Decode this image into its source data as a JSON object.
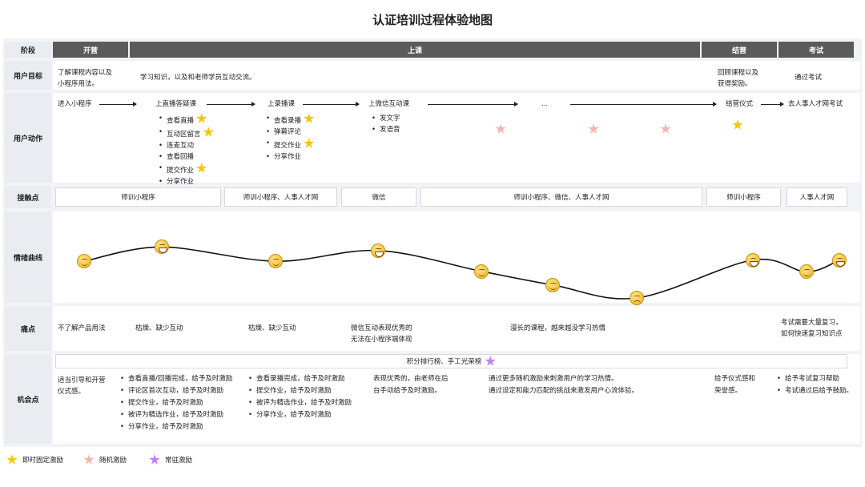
{
  "title": "认证培训过程体验地图",
  "row_labels": {
    "stage": "阶段",
    "goal": "用户目标",
    "action": "用户动作",
    "touch": "接触点",
    "emotion": "情绪曲线",
    "pain": "痛点",
    "opportunity": "机会点"
  },
  "phases": [
    "开营",
    "上课",
    "结营",
    "考试"
  ],
  "goals": [
    "了解课程内容以及",
    "小程序用法。",
    "学习知识，以及和老师学员互动交流。",
    "回顾课程以及",
    "获得奖励。",
    "通过考试"
  ],
  "actions": {
    "steps": [
      "进入小程序",
      "上直播答疑课",
      "上录播课",
      "上微信互动课",
      "...",
      "结营仪式",
      "去人事人才网考试"
    ],
    "live_items": [
      "查看直播",
      "互动区留言",
      "连麦互动",
      "查看回播",
      "提交作业",
      "分享作业"
    ],
    "recorded_items": [
      "查看录播",
      "弹幕评论",
      "提交作业",
      "分享作业"
    ],
    "wechat_items": [
      "发文字",
      "发语音"
    ]
  },
  "touchpoints": [
    "师训小程序",
    "师训小程序、人事人才网",
    "微信",
    "师训小程序、微信、人事人才网",
    "师训小程序",
    "人事人才网"
  ],
  "pains": {
    "p1": "不了解产品用法",
    "p2": "枯燥、缺少互动",
    "p3": "枯燥、缺少互动",
    "p4a": "微信互动表现优秀的",
    "p4b": "无法在小程序端体现",
    "p5": "漫长的课程，越来越没学习热情",
    "p6a": "考试需要大量复习，",
    "p6b": "如何快速复习知识点"
  },
  "opportunity": {
    "bar": "积分排行榜、手工光荣榜",
    "c1a": "适当引导和开营",
    "c1b": "仪式感。",
    "c2": [
      "查看直播/回播完成，给予及时激励",
      "评论区首次互动，给予及时激励",
      "提交作业，给予及时激励",
      "被评为精选作业，给予及时激励",
      "分享作业，给予及时激励"
    ],
    "c3": [
      "查看录播完成，给予及时激励",
      "提交作业，给予及时激励",
      "被评为精选作业，给予及时激励",
      "分享作业，给予及时激励"
    ],
    "c4a": "表现优秀的，由老师在后",
    "c4b": "台手动给予及时激励。",
    "c5a": "通过更多随机激励来刺激用户的学习热情。",
    "c5b": "通过设定和能力匹配的挑战来激发用户心流体验。",
    "c6a": "给予仪式感和",
    "c6b": "荣誉感。",
    "c7": [
      "给予考试复习帮助",
      "考试通过后给予鼓励。"
    ]
  },
  "legend": [
    "即时固定激励",
    "随机激励",
    "常驻激励"
  ],
  "colors": {
    "phase_bg": "#5b5b5b",
    "fixed_star": "#f7c600",
    "random_star": "#f6b4b0",
    "permanent_star": "#c57df0"
  },
  "emotion_curve": [
    {
      "point": "进入小程序",
      "level": 0.62,
      "face": "smile"
    },
    {
      "point": "上直播答疑课",
      "level": 0.86,
      "face": "grin"
    },
    {
      "point": "上录播课",
      "level": 0.62,
      "face": "smile"
    },
    {
      "point": "上微信互动课",
      "level": 0.8,
      "face": "grin"
    },
    {
      "point": "...",
      "level": 0.45,
      "face": "neutral"
    },
    {
      "point": "...",
      "level": 0.22,
      "face": "neutral"
    },
    {
      "point": "...",
      "level": 0.0,
      "face": "sad"
    },
    {
      "point": "结营仪式",
      "level": 0.64,
      "face": "grin"
    },
    {
      "point": "去人事人才网考试",
      "level": 0.44,
      "face": "neutral"
    },
    {
      "point": "end",
      "level": 0.64,
      "face": "grin"
    }
  ]
}
